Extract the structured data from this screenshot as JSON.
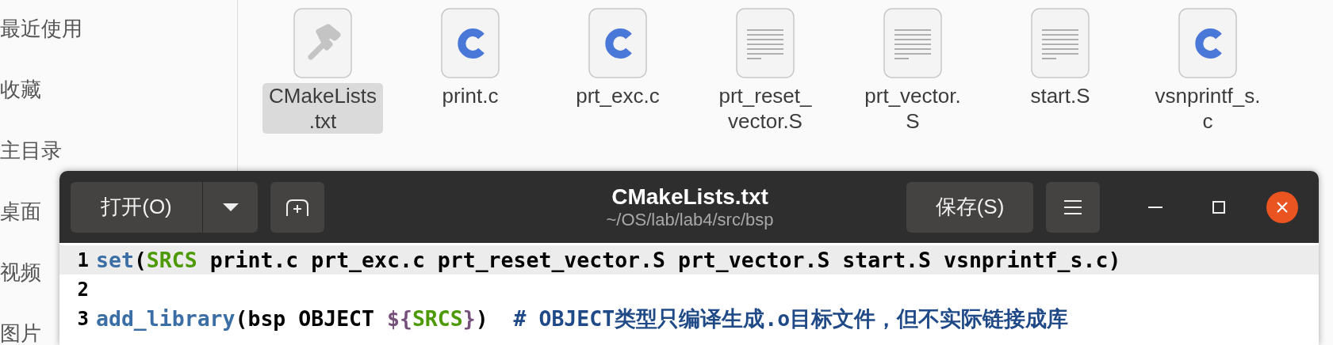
{
  "sidebar": {
    "items": [
      {
        "label": "最近使用",
        "selected": false
      },
      {
        "label": "收藏",
        "selected": false
      },
      {
        "label": "主目录",
        "selected": false
      },
      {
        "label": "桌面",
        "selected": false
      },
      {
        "label": "视频",
        "selected": false
      },
      {
        "label": "图片",
        "selected": false
      }
    ]
  },
  "files": [
    {
      "kind": "cmake",
      "name_lines": [
        "CMakeLists",
        ".txt"
      ],
      "selected": true
    },
    {
      "kind": "c",
      "name_lines": [
        "print.c"
      ],
      "selected": false
    },
    {
      "kind": "c",
      "name_lines": [
        "prt_exc.c"
      ],
      "selected": false
    },
    {
      "kind": "text",
      "name_lines": [
        "prt_reset_",
        "vector.S"
      ],
      "selected": false
    },
    {
      "kind": "text",
      "name_lines": [
        "prt_vector.",
        "S"
      ],
      "selected": false
    },
    {
      "kind": "text",
      "name_lines": [
        "start.S"
      ],
      "selected": false
    },
    {
      "kind": "c",
      "name_lines": [
        "vsnprintf_s.",
        "c"
      ],
      "selected": false
    }
  ],
  "editor": {
    "open_button": "打开(O)",
    "title": "CMakeLists.txt",
    "subtitle": "~/OS/lab/lab4/src/bsp",
    "save_button": "保存(S)",
    "lines": [
      {
        "number": "1",
        "current": true,
        "tokens": [
          {
            "kind": "function",
            "text": "set"
          },
          {
            "kind": "plain",
            "text": "("
          },
          {
            "kind": "variable",
            "text": "SRCS"
          },
          {
            "kind": "plain",
            "text": " print.c prt_exc.c prt_reset_vector.S prt_vector.S start.S vsnprintf_s.c)"
          }
        ]
      },
      {
        "number": "2",
        "current": false
      },
      {
        "number": "3",
        "current": false,
        "tokens": [
          {
            "kind": "function",
            "text": "add_library"
          },
          {
            "kind": "plain",
            "text": "(bsp OBJECT "
          },
          {
            "kind": "special",
            "text": "${"
          },
          {
            "kind": "variable",
            "text": "SRCS"
          },
          {
            "kind": "special",
            "text": "}"
          },
          {
            "kind": "plain",
            "text": ")  "
          },
          {
            "kind": "comment",
            "text": "# OBJECT类型只编译生成.o目标文件，但不实际链接成库"
          }
        ]
      }
    ]
  }
}
